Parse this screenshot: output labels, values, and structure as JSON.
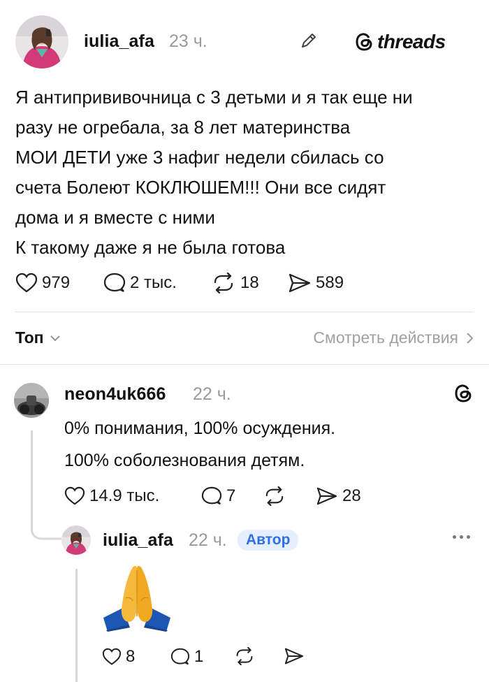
{
  "post": {
    "author": "iulia_afa",
    "time": "23 ч.",
    "brand": "threads",
    "lines": [
      "Я антипрививочница с 3 детьми и я так еще ни",
      "разу не огребала, за 8 лет материнства",
      "МОИ ДЕТИ уже 3 нафиг недели сбилась со",
      "счета Болеют КОКЛЮШЕМ!!! Они все сидят",
      "дома и я вместе с ними",
      "К такому даже я не была готова"
    ],
    "likes": "979",
    "replies": "2 тыс.",
    "reposts": "18",
    "shares": "589"
  },
  "sort": {
    "label": "Топ",
    "view_activity": "Смотреть действия"
  },
  "comment": {
    "author": "neon4uk666",
    "time": "22 ч.",
    "lines": [
      "0% понимания, 100% осуждения.",
      "100% соболезнования детям."
    ],
    "likes": "14.9 тыс.",
    "replies": "7",
    "shares": "28"
  },
  "reply": {
    "author": "iulia_afa",
    "time": "22 ч.",
    "badge": "Автор",
    "content_emoji": "folded-hands",
    "likes": "8",
    "replies": "1"
  },
  "colors": {
    "text": "#111111",
    "muted": "#9a9a9a",
    "badge_bg": "#e5efff",
    "badge_text": "#2f6fe0",
    "divider": "#e3e3e3"
  }
}
